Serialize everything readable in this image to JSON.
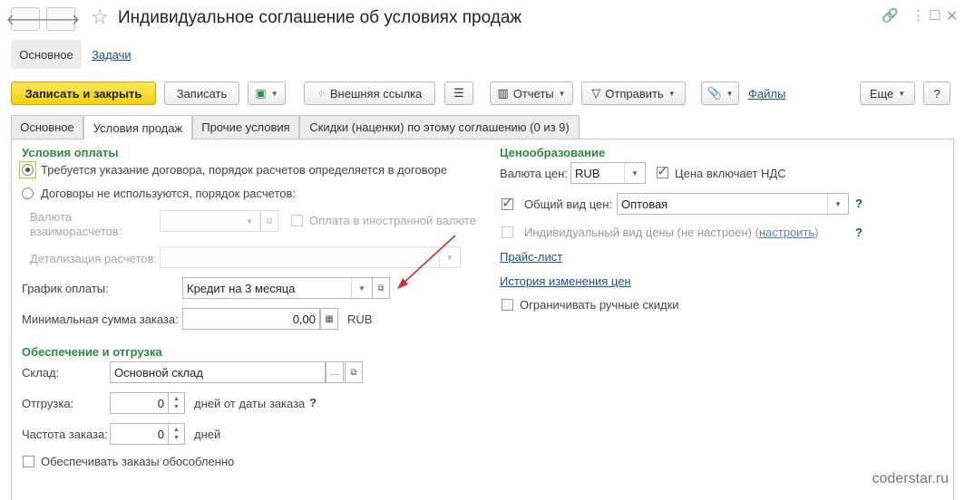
{
  "window": {
    "title": "Индивидуальное соглашение об условиях продаж"
  },
  "section_tabs": {
    "main": "Основное",
    "tasks": "Задачи"
  },
  "toolbar": {
    "save_close": "Записать и закрыть",
    "save": "Записать",
    "external_link": "Внешняя ссылка",
    "reports": "Отчеты",
    "send": "Отправить",
    "files": "Файлы",
    "more": "Еще",
    "help": "?"
  },
  "tabs": [
    {
      "label": "Основное",
      "active": false
    },
    {
      "label": "Условия продаж",
      "active": true
    },
    {
      "label": "Прочие условия",
      "active": false
    },
    {
      "label": "Скидки (наценки) по этому соглашению (0 из 9)",
      "active": false
    }
  ],
  "payment": {
    "header": "Условия оплаты",
    "radio1": "Требуется указание договора, порядок расчетов определяется в договоре",
    "radio2": "Договоры не используются, порядок расчетов:",
    "settle_currency_label": "Валюта взаиморасчетов:",
    "foreign_currency": "Оплата в иностранной валюте",
    "detail_label": "Детализация расчетов:",
    "schedule_label": "График оплаты:",
    "schedule_value": "Кредит на 3 месяца",
    "min_sum_label": "Минимальная сумма заказа:",
    "min_sum_value": "0,00",
    "min_sum_currency": "RUB"
  },
  "shipping": {
    "header": "Обеспечение и отгрузка",
    "warehouse_label": "Склад:",
    "warehouse_value": "Основной склад",
    "shipment_label": "Отгрузка:",
    "shipment_value": "0",
    "shipment_suffix": "дней от даты заказа",
    "frequency_label": "Частота заказа:",
    "frequency_value": "0",
    "frequency_suffix": "дней",
    "separate_orders": "Обеспечивать заказы обособленно"
  },
  "pricing": {
    "header": "Ценообразование",
    "currency_label": "Валюта цен:",
    "currency_value": "RUB",
    "vat_included": "Цена включает НДС",
    "general_price_label": "Общий вид цен:",
    "general_price_value": "Оптовая",
    "individual_price_prefix": "Индивидуальный вид цены (не настроен) (",
    "configure_link": "настроить",
    "individual_price_suffix": ")",
    "price_list": "Прайс-лист",
    "price_history": "История изменения цен",
    "limit_discounts": "Ограничивать ручные скидки"
  },
  "watermark": "coderstar.ru",
  "colors": {
    "accent": "#f1cf14",
    "section_header": "#2d8a3e",
    "link": "#1a4f9c",
    "arrow": "#d0312d"
  }
}
